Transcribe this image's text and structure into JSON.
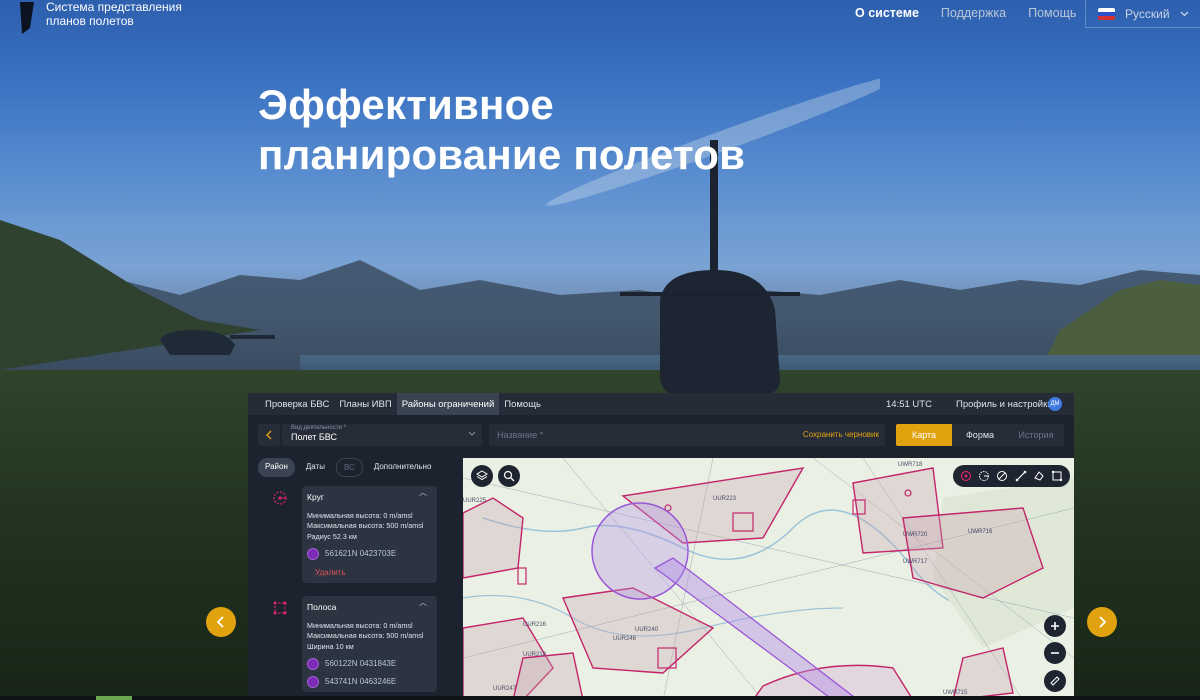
{
  "header": {
    "logo_text": "Система представления планов полетов",
    "nav": [
      {
        "label": "О системе",
        "active": true
      },
      {
        "label": "Поддержка",
        "active": false
      },
      {
        "label": "Помощь",
        "active": false
      }
    ],
    "language": "Русский"
  },
  "hero": {
    "title": "Эффективное планирование полетов"
  },
  "app": {
    "tabs": [
      {
        "label": "Проверка БВС",
        "active": false
      },
      {
        "label": "Планы ИВП",
        "active": false
      },
      {
        "label": "Районы ограничений",
        "active": true
      },
      {
        "label": "Помощь",
        "active": false
      }
    ],
    "time": "14:51 UTC",
    "profile_label": "Профиль и настройки",
    "avatar_initials": "ДМ",
    "form": {
      "activity_label": "Вид деятельности *",
      "activity_value": "Полет БВС",
      "name_placeholder": "Название *",
      "save_draft": "Сохранить черновик",
      "view_tabs": [
        {
          "label": "Карта",
          "state": "active"
        },
        {
          "label": "Форма",
          "state": "normal"
        },
        {
          "label": "История",
          "state": "disabled"
        }
      ]
    },
    "sidebar": {
      "pills": [
        {
          "label": "Район",
          "state": "active"
        },
        {
          "label": "Даты",
          "state": "normal"
        },
        {
          "label": "ВС",
          "state": "disabled"
        },
        {
          "label": "Дополнительно",
          "state": "normal"
        }
      ],
      "zones": [
        {
          "title": "Круг",
          "min_alt": "Минимальная высота: 0 m/amsl",
          "max_alt": "Максимальная высота: 500 m/amsl",
          "extra": "Радиус 52.3 км",
          "coords": [
            "561621N 0423703E"
          ],
          "delete_label": "Удалить"
        },
        {
          "title": "Полоса",
          "min_alt": "Минимальная высота: 0 m/amsl",
          "max_alt": "Максимальная высота: 500 m/amsl",
          "extra": "Ширина 10 км",
          "coords": [
            "560122N 0431843E",
            "543741N 0463246E"
          ]
        }
      ]
    },
    "map": {
      "labels": [
        "UUR223",
        "UWR718",
        "UWR716",
        "UWR720",
        "UWR717",
        "UUR218",
        "UUR240",
        "UUR246",
        "UWR715",
        "UUR247",
        "UUR225",
        "UUR240",
        "UUR216"
      ],
      "tool_icons": [
        "circle-draw-icon",
        "circle-radius-icon",
        "line-icon",
        "polyline-icon",
        "polygon-icon",
        "rectangle-icon"
      ]
    }
  },
  "colors": {
    "accent": "#e0a30f",
    "panel": "#1d232e",
    "zone_pink": "#d6256e",
    "zone_purple": "#a56be0"
  }
}
